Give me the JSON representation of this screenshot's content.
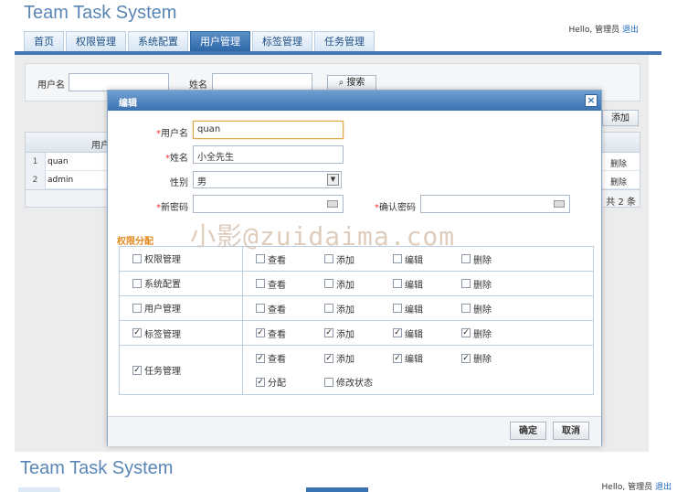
{
  "app": {
    "title": "Team Task System"
  },
  "user": {
    "greeting": "Hello,",
    "name": "管理员",
    "logout": "退出"
  },
  "nav": {
    "tabs": [
      "首页",
      "权限管理",
      "系统配置",
      "用户管理",
      "标签管理",
      "任务管理"
    ],
    "active": "用户管理"
  },
  "search": {
    "username_label": "用户名",
    "name_label": "姓名",
    "button": "搜索",
    "username_value": "",
    "name_value": ""
  },
  "toolbar": {
    "add_label": "添加"
  },
  "grid": {
    "header_username": "用户名",
    "rows": [
      {
        "no": "1",
        "username": "quan",
        "action": "删除"
      },
      {
        "no": "2",
        "username": "admin",
        "action": "删除"
      }
    ],
    "footer": "共 2 条"
  },
  "dialog": {
    "title": "编辑",
    "close": "×",
    "fields": {
      "username": {
        "label": "用户名",
        "required": "*",
        "value": "quan"
      },
      "name": {
        "label": "姓名",
        "required": "*",
        "value": "小全先生"
      },
      "gender": {
        "label": "性别",
        "value": "男"
      },
      "new_password": {
        "label": "新密码",
        "required": "*",
        "value": ""
      },
      "confirm_password": {
        "label": "确认密码",
        "required": "*",
        "value": ""
      }
    },
    "permissions": {
      "heading": "权限分配",
      "modules": [
        {
          "name": "权限管理",
          "checked": false,
          "actions": [
            [
              "查看",
              false
            ],
            [
              "添加",
              false
            ],
            [
              "编辑",
              false
            ],
            [
              "删除",
              false
            ]
          ]
        },
        {
          "name": "系统配置",
          "checked": false,
          "actions": [
            [
              "查看",
              false
            ],
            [
              "添加",
              false
            ],
            [
              "编辑",
              false
            ],
            [
              "删除",
              false
            ]
          ]
        },
        {
          "name": "用户管理",
          "checked": false,
          "actions": [
            [
              "查看",
              false
            ],
            [
              "添加",
              false
            ],
            [
              "编辑",
              false
            ],
            [
              "删除",
              false
            ]
          ]
        },
        {
          "name": "标签管理",
          "checked": true,
          "actions": [
            [
              "查看",
              true
            ],
            [
              "添加",
              true
            ],
            [
              "编辑",
              true
            ],
            [
              "删除",
              true
            ]
          ]
        },
        {
          "name": "任务管理",
          "checked": true,
          "actions": [
            [
              "查看",
              true
            ],
            [
              "添加",
              true
            ],
            [
              "编辑",
              true
            ],
            [
              "删除",
              true
            ],
            [
              "分配",
              true
            ],
            [
              "修改状态",
              false
            ]
          ]
        }
      ]
    },
    "confirm": "确定",
    "cancel": "取消"
  },
  "watermark": "小影@zuidaima.com",
  "colors": {
    "primary": "#3b72b2",
    "tab_active": "#2f68a8",
    "required": "#e33333",
    "heading": "#e58a1f",
    "focus_border": "#e3a54a"
  }
}
